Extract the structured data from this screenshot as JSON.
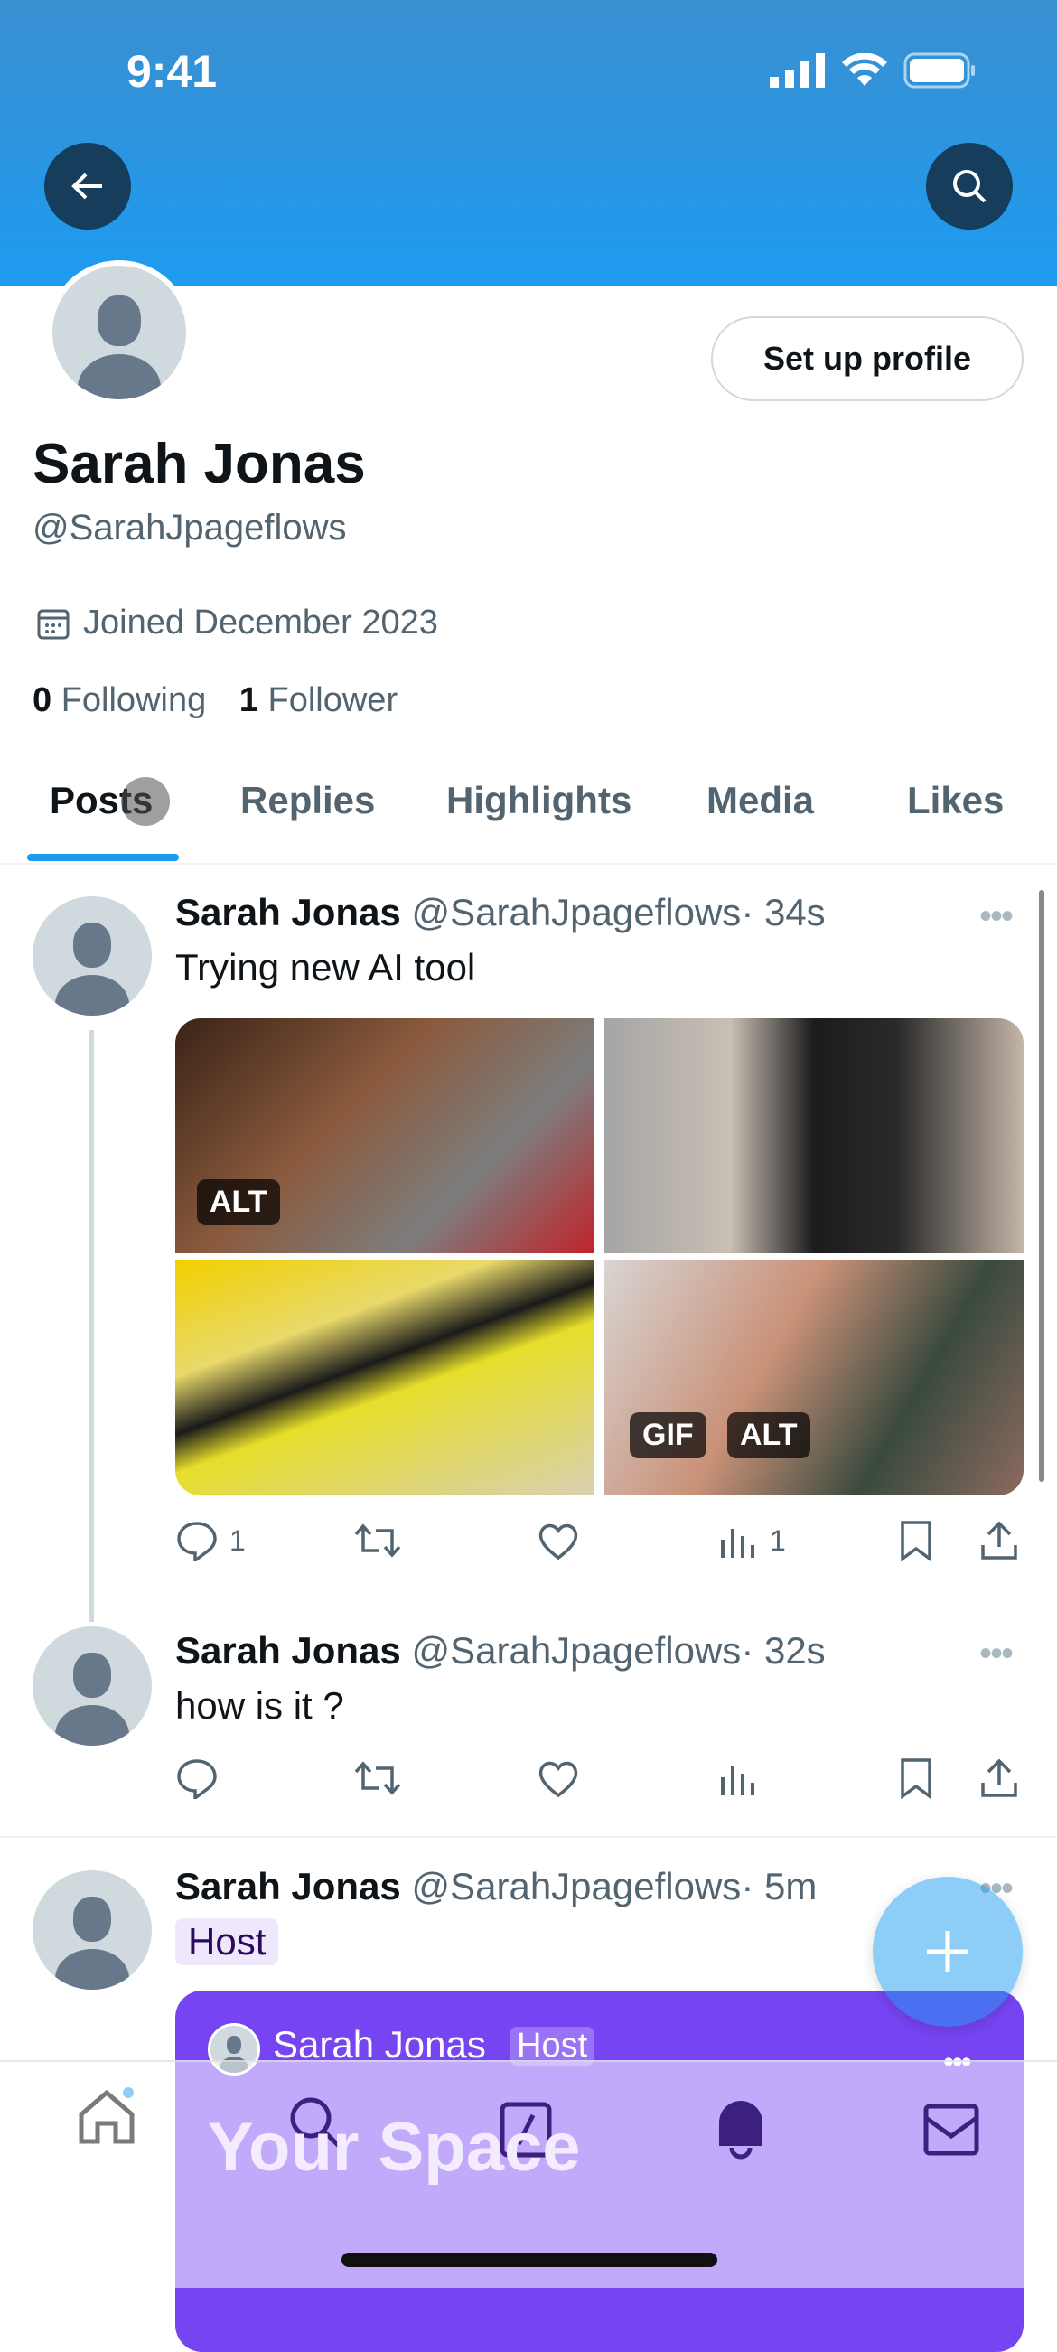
{
  "status": {
    "time": "9:41"
  },
  "profile": {
    "name": "Sarah Jonas",
    "handle": "@SarahJpageflows",
    "joined": "Joined December 2023",
    "following_count": "0",
    "following_label": "Following",
    "followers_count": "1",
    "followers_label": "Follower",
    "setup_label": "Set up profile"
  },
  "tabs": [
    {
      "label": "Posts",
      "active": true
    },
    {
      "label": "Replies"
    },
    {
      "label": "Highlights"
    },
    {
      "label": "Media"
    },
    {
      "label": "Likes"
    }
  ],
  "posts": [
    {
      "name": "Sarah Jonas",
      "handle": "@SarahJpageflows",
      "time": "· 34s",
      "text": "Trying new AI tool",
      "media_badges": [
        "ALT",
        "GIF",
        "ALT"
      ],
      "replies": "1",
      "views": "1"
    },
    {
      "name": "Sarah Jonas",
      "handle": "@SarahJpageflows",
      "time": "· 32s",
      "text": "how is it ?"
    },
    {
      "name": "Sarah Jonas",
      "handle": "@SarahJpageflows",
      "time": "· 5m",
      "badge": "Host",
      "space": {
        "host_name": "Sarah Jonas",
        "host_badge": "Host",
        "title": "Your Space"
      }
    }
  ],
  "colors": {
    "accent": "#1d9bf0",
    "space": "#7744f2"
  },
  "nav": [
    "home-icon",
    "search-icon",
    "spaces-icon",
    "notifications-icon",
    "messages-icon"
  ]
}
